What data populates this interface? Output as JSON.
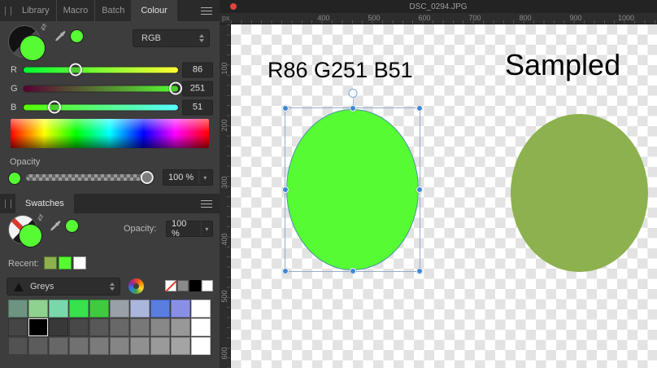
{
  "panel_tabs": {
    "items": [
      "Library",
      "Macro",
      "Batch",
      "Colour"
    ],
    "active": "Colour"
  },
  "icons": {
    "swap_arrows": "⇄",
    "dropdown_caret": "▾"
  },
  "colour_panel": {
    "mode": "RGB",
    "current_color": "#56FB33",
    "sliders": [
      {
        "label": "R",
        "value": 86,
        "max": 255,
        "gradient": [
          "#00fb33",
          "#fffb33"
        ]
      },
      {
        "label": "G",
        "value": 251,
        "max": 255,
        "gradient": [
          "#560033",
          "#56ff33"
        ]
      },
      {
        "label": "B",
        "value": 51,
        "max": 255,
        "gradient": [
          "#56fb00",
          "#56fbff"
        ]
      }
    ],
    "opacity_label": "Opacity",
    "opacity_value": "100 %"
  },
  "swatches_panel": {
    "title": "Swatches",
    "current_color": "#56FB33",
    "opacity_label": "Opacity:",
    "opacity_value": "100 %",
    "recent_label": "Recent:",
    "recent": [
      "#8CB14E",
      "#56FB33",
      "#FFFFFF"
    ],
    "category": "Greys",
    "quick": [
      "none",
      "#8a8a8a",
      "#000000",
      "#ffffff"
    ],
    "grid": [
      [
        "#6c9480",
        "#8fd18f",
        "#79d8ab",
        "#37e24c",
        "#3fca3f",
        "#9aa0a8",
        "#aab6dc",
        "#5a7de0",
        "#8a8fe6",
        "#ffffff"
      ],
      [
        "#454545",
        "#000000",
        "#383838",
        "#484848",
        "#585858",
        "#686868",
        "#787878",
        "#888888",
        "#989898",
        "#ffffff"
      ],
      [
        "#525252",
        "#5c5c5c",
        "#676767",
        "#717171",
        "#7b7b7b",
        "#858585",
        "#909090",
        "#9a9a9a",
        "#a4a4a4",
        "#ffffff"
      ]
    ],
    "selected_cell": [
      1,
      1
    ]
  },
  "canvas": {
    "title": "DSC_0294.JPG",
    "ruler_unit": "px",
    "ruler_h": [
      "400",
      "500",
      "600",
      "700",
      "800",
      "900",
      "1000"
    ],
    "ruler_v": [
      "100",
      "200",
      "300",
      "400",
      "500",
      "600"
    ],
    "labels": {
      "specified": "R86 G251 B51",
      "sampled": "Sampled"
    },
    "ellipses": [
      {
        "name": "specified",
        "color": "#56FB33",
        "selected": true
      },
      {
        "name": "sampled",
        "color": "#8CB14E",
        "selected": false
      }
    ]
  }
}
